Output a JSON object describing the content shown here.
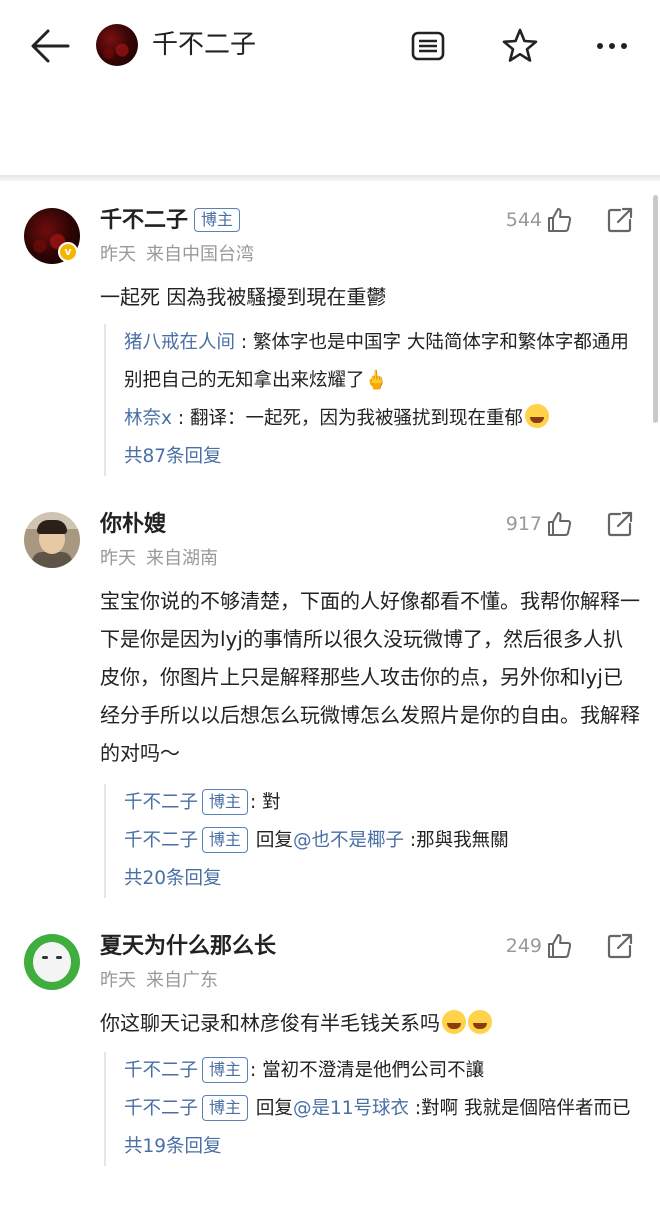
{
  "header": {
    "title": "千不二子",
    "back_icon": "back-arrow-icon",
    "icons": [
      "document-list-icon",
      "star-icon",
      "more-dots-icon"
    ]
  },
  "comments": [
    {
      "name": "千不二子",
      "tag": "博主",
      "time": "昨天",
      "source": "来自中国台湾",
      "likes": "544",
      "text": "一起死 因為我被騷擾到現在重鬱",
      "replies": [
        {
          "name": "猪八戒在人间",
          "text": "繁体字也是中国字 大陆简体字和繁体字都通用 别把自己的无知拿出来炫耀了🖕"
        },
        {
          "name": "林奈x",
          "text": "翻译：一起死，因为我被骚扰到现在重郁"
        }
      ],
      "more": "共87条回复"
    },
    {
      "name": "你朴嫂",
      "time": "昨天",
      "source": "来自湖南",
      "likes": "917",
      "text": "宝宝你说的不够清楚，下面的人好像都看不懂。我帮你解释一下是你是因为lyj的事情所以很久没玩微博了，然后很多人扒皮你，你图片上只是解释那些人攻击你的点，另外你和lyj已经分手所以以后想怎么玩微博怎么发照片是你的自由。我解释的对吗～",
      "replies": [
        {
          "name": "千不二子",
          "tag": "博主",
          "text": "對"
        },
        {
          "name": "千不二子",
          "tag": "博主",
          "prefix": "回复",
          "mention": "@也不是椰子",
          "text": "那與我無關"
        }
      ],
      "more": "共20条回复"
    },
    {
      "name": "夏天为什么那么长",
      "time": "昨天",
      "source": "来自广东",
      "likes": "249",
      "text": "你这聊天记录和林彦俊有半毛钱关系吗",
      "replies": [
        {
          "name": "千不二子",
          "tag": "博主",
          "text": "當初不澄清是他們公司不讓"
        },
        {
          "name": "千不二子",
          "tag": "博主",
          "prefix": "回复",
          "mention": "@是11号球衣",
          "text": "對啊 我就是個陪伴者而已"
        }
      ],
      "more": "共19条回复"
    }
  ]
}
